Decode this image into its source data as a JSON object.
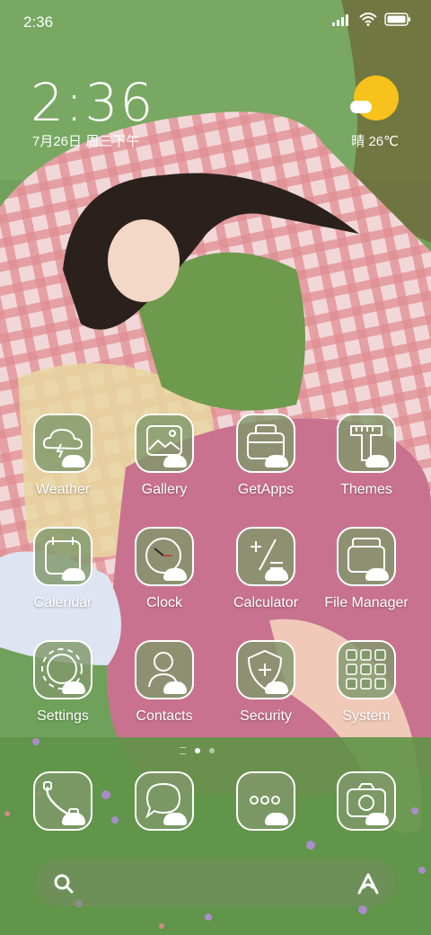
{
  "status_bar": {
    "time": "2:36",
    "signal_icon": "signal-icon",
    "wifi_icon": "wifi-icon",
    "battery_icon": "battery-icon"
  },
  "clock_widget": {
    "time": "2:36",
    "date": "7月26日 周三下午"
  },
  "weather_widget": {
    "condition": "晴 26℃",
    "icon": "sun-icon"
  },
  "apps": [
    {
      "label": "Weather",
      "icon": "weather-icon"
    },
    {
      "label": "Gallery",
      "icon": "gallery-icon"
    },
    {
      "label": "GetApps",
      "icon": "getapps-icon"
    },
    {
      "label": "Themes",
      "icon": "themes-icon"
    },
    {
      "label": "Calendar",
      "icon": "calendar-icon"
    },
    {
      "label": "Clock",
      "icon": "clock-icon"
    },
    {
      "label": "Calculator",
      "icon": "calculator-icon"
    },
    {
      "label": "File Manager",
      "icon": "file-manager-icon"
    },
    {
      "label": "Settings",
      "icon": "settings-icon"
    },
    {
      "label": "Contacts",
      "icon": "contacts-icon"
    },
    {
      "label": "Security",
      "icon": "security-icon"
    },
    {
      "label": "System",
      "icon": "system-folder-icon"
    }
  ],
  "dock": [
    {
      "icon": "phone-icon"
    },
    {
      "icon": "messages-icon"
    },
    {
      "icon": "more-apps-icon"
    },
    {
      "icon": "camera-icon"
    }
  ],
  "page_indicator": {
    "pages": 2,
    "active": 1
  },
  "search_bar": {
    "search_icon": "search-icon",
    "assistant_icon": "assistant-icon"
  },
  "colors": {
    "grass": "#6a9a52",
    "tile": "#80986a",
    "blanket": "#e8b4b8",
    "dress": "#c9728f"
  }
}
